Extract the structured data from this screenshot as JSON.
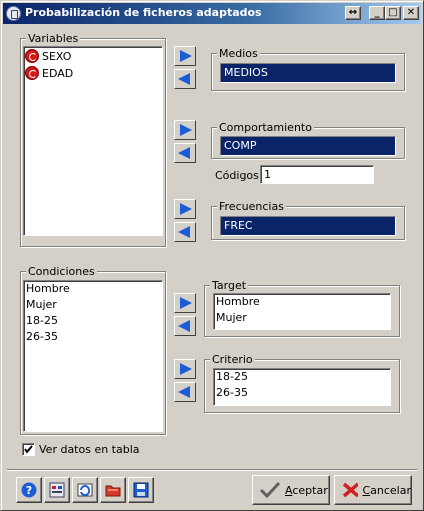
{
  "window": {
    "title": "Probabilización de ficheros adaptados",
    "controls": {
      "restore": "↔",
      "minimize": "_",
      "maximize": "□",
      "close": "✕"
    }
  },
  "variables": {
    "legend": "Variables",
    "items": [
      {
        "label": "SEXO",
        "icon": "variable-icon"
      },
      {
        "label": "EDAD",
        "icon": "variable-icon"
      }
    ]
  },
  "medios": {
    "legend": "Medios",
    "value": "MEDIOS"
  },
  "comportamiento": {
    "legend": "Comportamiento",
    "value": "COMP"
  },
  "codigos": {
    "label": "Códigos",
    "value": "1"
  },
  "frecuencias": {
    "legend": "Frecuencias",
    "value": "FREC"
  },
  "condiciones": {
    "legend": "Condiciones",
    "items": [
      "Hombre",
      "Mujer",
      "18-25",
      "26-35"
    ]
  },
  "target": {
    "legend": "Target",
    "items": [
      "Hombre",
      "Mujer"
    ]
  },
  "criterio": {
    "legend": "Criterio",
    "items": [
      "18-25",
      "26-35"
    ]
  },
  "ver_datos": {
    "label": "Ver datos en tabla",
    "checked": true
  },
  "toolbar": {
    "icons": [
      "help-icon",
      "settings-icon",
      "refresh-icon",
      "folder-icon",
      "save-icon"
    ]
  },
  "buttons": {
    "accept": {
      "underlined": "A",
      "rest": "ceptar"
    },
    "cancel": {
      "underlined": "C",
      "rest": "ancelar"
    }
  },
  "colors": {
    "selection_blue": "#0a246a",
    "arrow_blue": "#1c5cd6",
    "face": "#d4d0c8"
  }
}
